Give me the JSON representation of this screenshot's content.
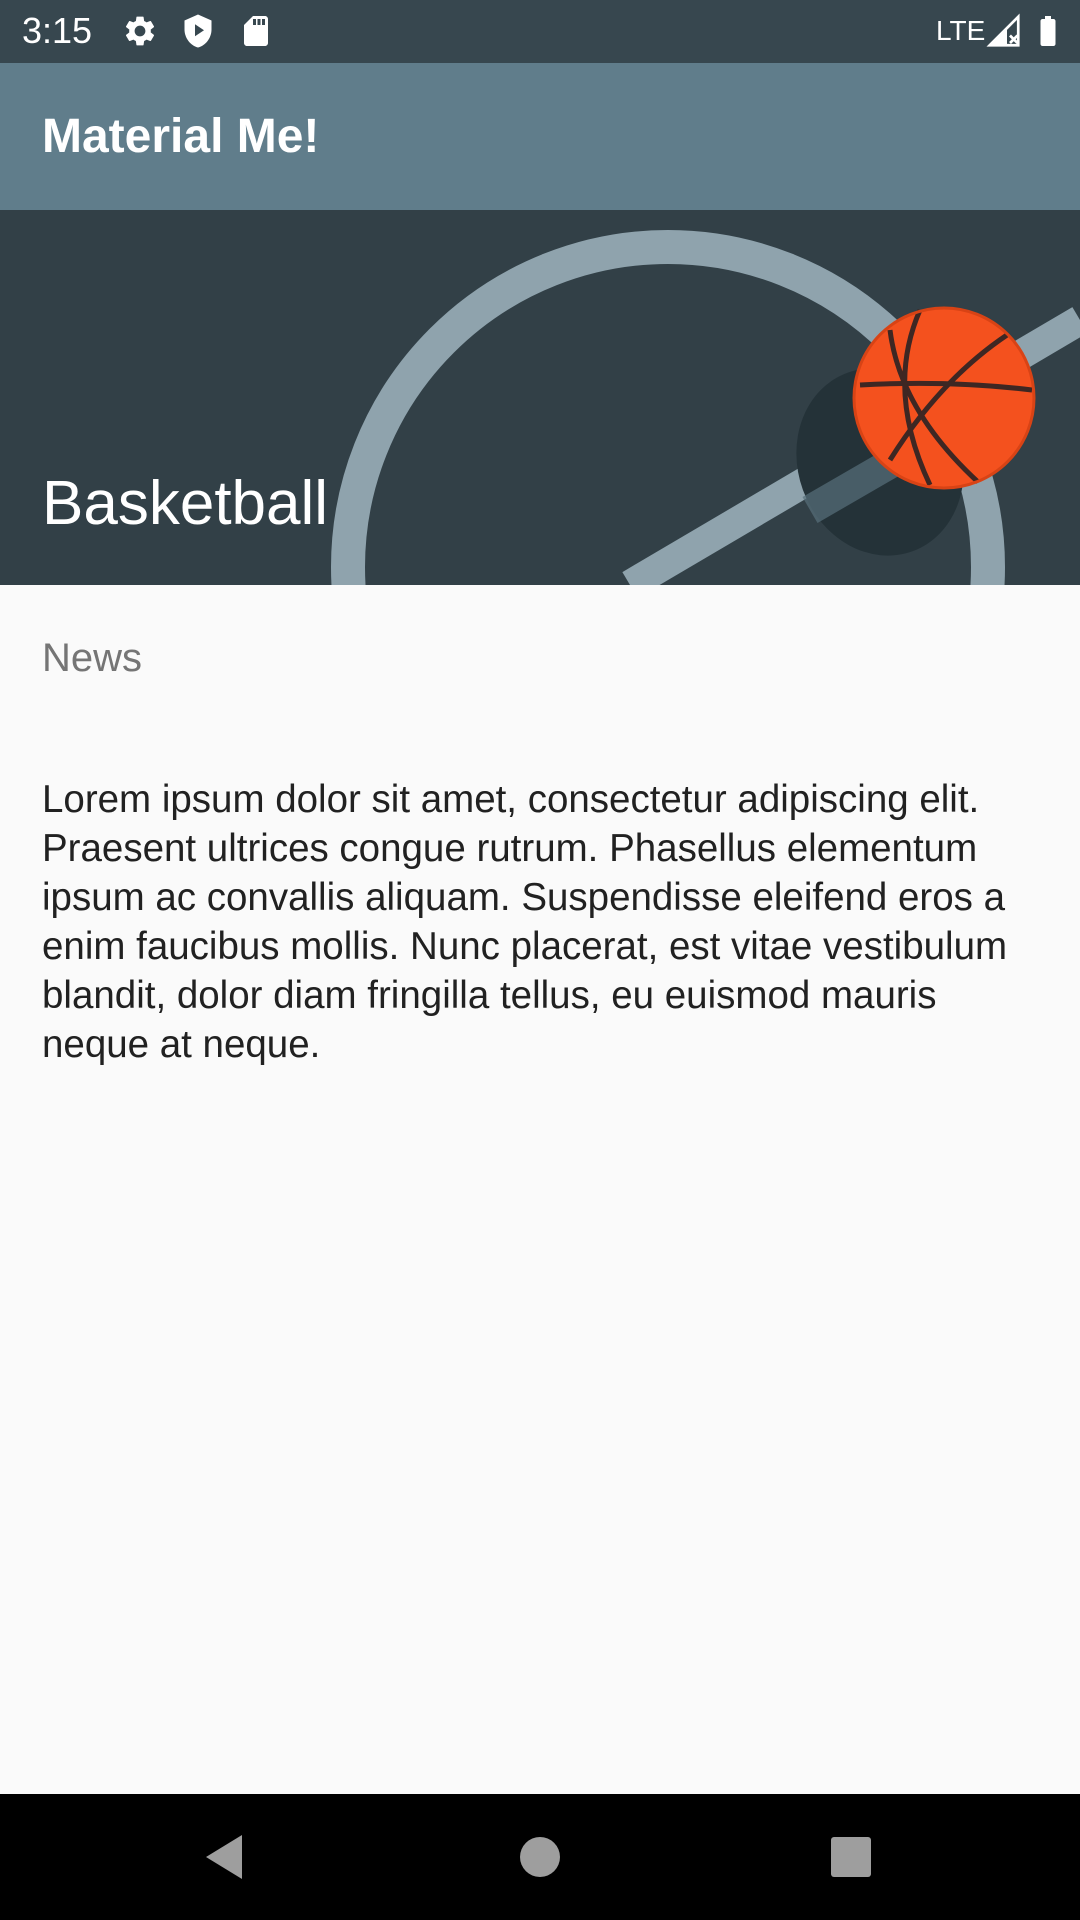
{
  "status_bar": {
    "time": "3:15",
    "network": "LTE",
    "icons": [
      "gear-icon",
      "shield-play-icon",
      "sd-card-icon",
      "signal-icon",
      "battery-icon"
    ]
  },
  "app_bar": {
    "title": "Material Me!"
  },
  "card": {
    "title": "Basketball",
    "subtitle": "News",
    "body": "Lorem ipsum dolor sit amet, consectetur adipiscing elit. Praesent ultrices congue rutrum. Phasellus elementum ipsum ac convallis aliquam. Suspendisse eleifend eros a enim faucibus mollis. Nunc placerat, est vitae vestibulum blandit, dolor diam fringilla tellus, eu euismod mauris neque at neque.",
    "image": "basketball-court-illustration"
  },
  "nav_bar": {
    "buttons": [
      "back-icon",
      "home-icon",
      "recents-icon"
    ]
  },
  "colors": {
    "status_bar": "#37474f",
    "app_bar": "#607d8b",
    "hero_background": "#324047",
    "court_lines": "#8fa3ad",
    "ball": "#f4511e",
    "page_background": "#fafafa"
  }
}
